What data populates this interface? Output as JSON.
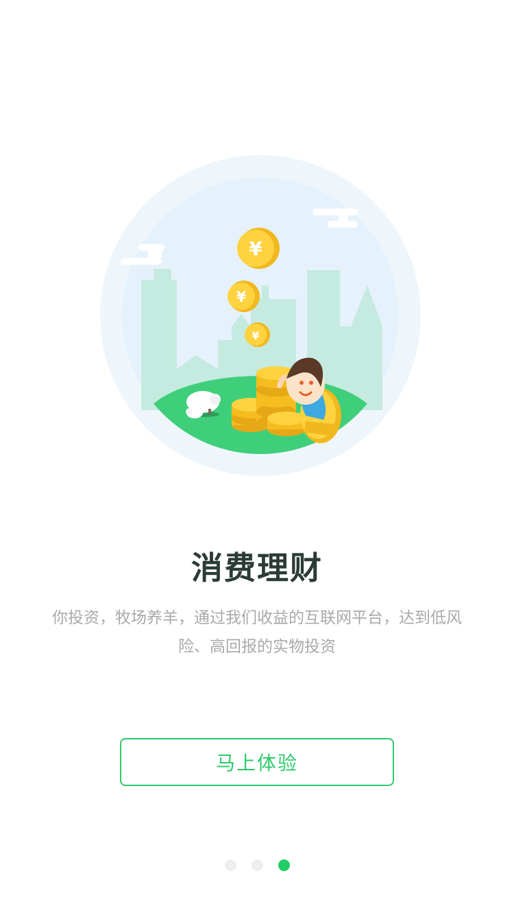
{
  "onboarding": {
    "title": "消费理财",
    "description_line1": "你投资，牧场养羊，通过我们收益的互联网平台，达到低风",
    "description_line2": "险、高回报的实物投资",
    "cta_label": "马上体验",
    "page_indicator": {
      "total": 3,
      "active_index": 2
    }
  },
  "illustration": {
    "coin_symbol": "¥",
    "icon": "finance-illustration"
  },
  "colors": {
    "accent": "#2fc96b",
    "indicator_active": "#22cc66",
    "indicator_inactive": "#eeeeee",
    "title": "#2b3b38",
    "description": "#a9a9a9"
  }
}
